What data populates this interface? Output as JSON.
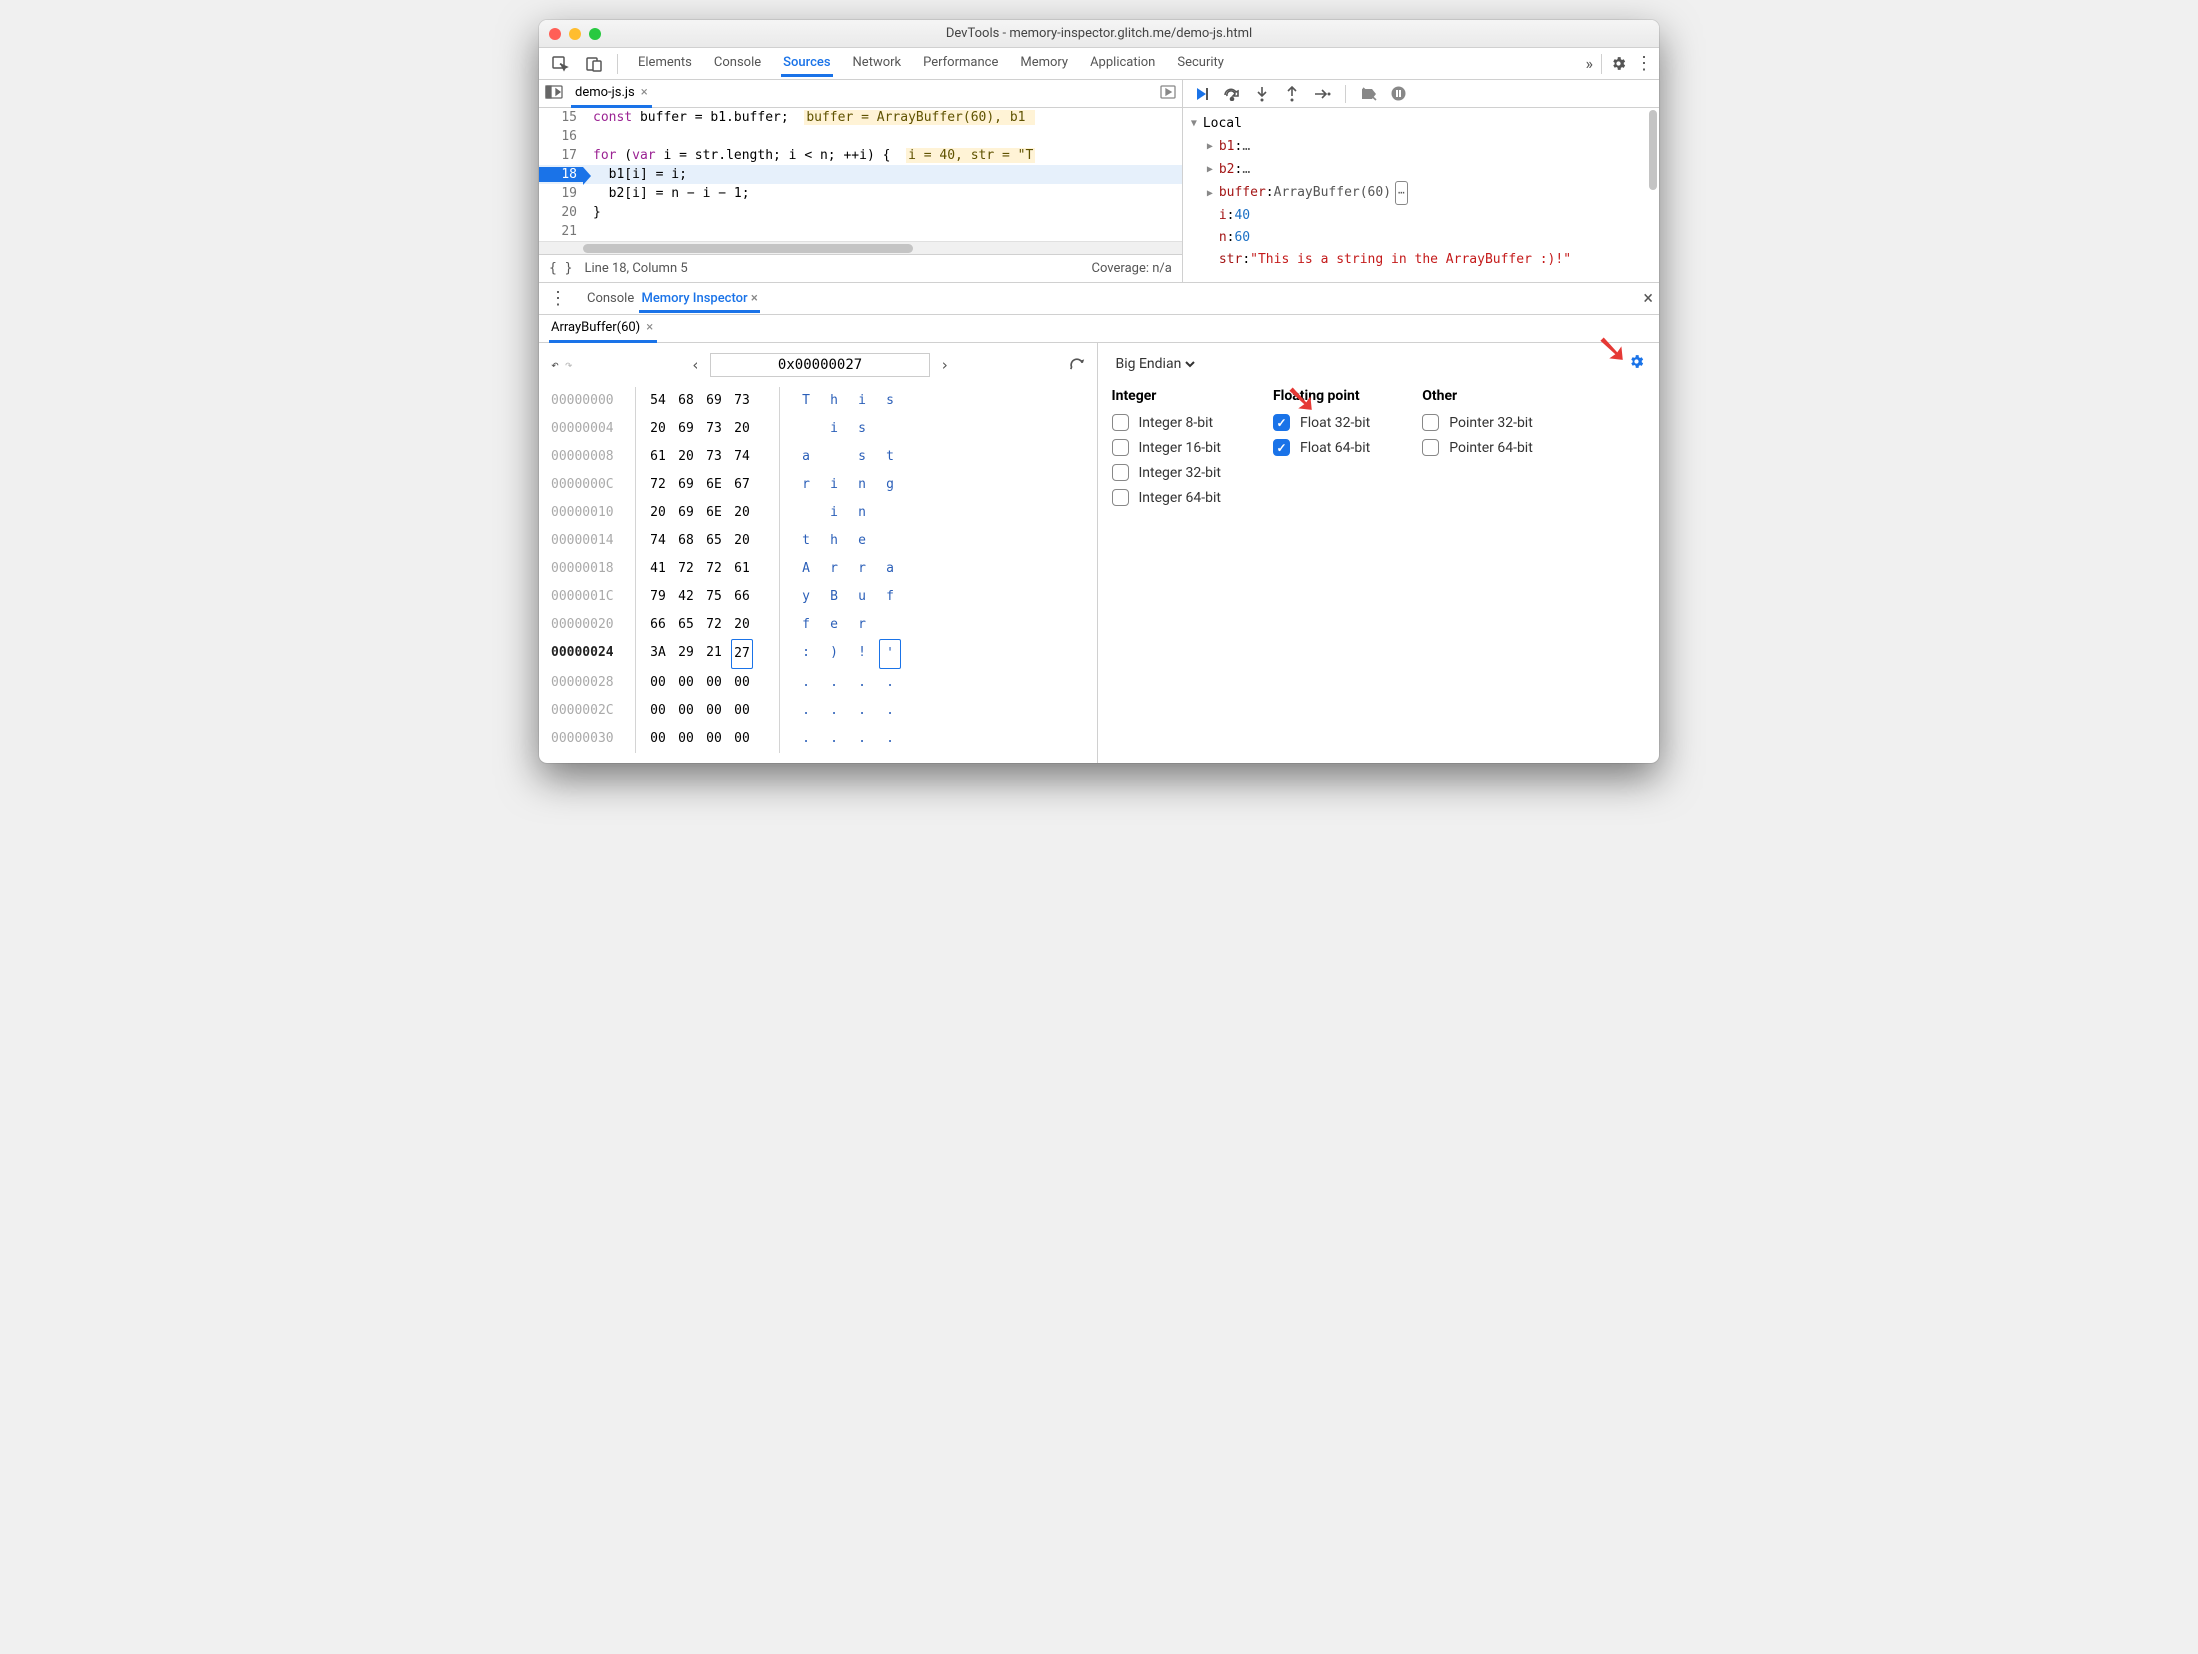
{
  "titlebar": {
    "title": "DevTools - memory-inspector.glitch.me/demo-js.html"
  },
  "tabs": {
    "items": [
      "Elements",
      "Console",
      "Sources",
      "Network",
      "Performance",
      "Memory",
      "Application",
      "Security"
    ],
    "active": "Sources",
    "more": "»"
  },
  "sources": {
    "file_tab": "demo-js.js",
    "lines": [
      {
        "n": "15",
        "html": "<span class='kw'>const</span> buffer = b1.buffer;&nbsp; <span class='hint'>buffer = ArrayBuffer(60), b1 </span>"
      },
      {
        "n": "16",
        "html": ""
      },
      {
        "n": "17",
        "html": "<span class='kw'>for</span> (<span class='kw'>var</span> i = str.length; i &lt; n; ++i) {&nbsp; <span class='hint'>i = 40, str = \"T</span>"
      },
      {
        "n": "18",
        "html": "&nbsp;&nbsp;b1[i] = i;",
        "active": true
      },
      {
        "n": "19",
        "html": "&nbsp;&nbsp;b2[i] = n &minus; i &minus; 1;"
      },
      {
        "n": "20",
        "html": "}"
      },
      {
        "n": "21",
        "html": ""
      }
    ],
    "status": {
      "pos": "Line 18, Column 5",
      "coverage": "Coverage: n/a"
    }
  },
  "scope": {
    "header": "Local",
    "entries": [
      {
        "key": "b1",
        "val": "…",
        "expandable": true
      },
      {
        "key": "b2",
        "val": "…",
        "expandable": true
      },
      {
        "key": "buffer",
        "val": "ArrayBuffer(60)",
        "expandable": true,
        "memicon": true
      },
      {
        "key": "i",
        "val": "40",
        "num": true
      },
      {
        "key": "n",
        "val": "60",
        "num": true
      },
      {
        "key": "str",
        "val": "\"This is a string in the ArrayBuffer :)!\"",
        "str": true
      }
    ]
  },
  "drawer": {
    "tabs": [
      "Console",
      "Memory Inspector"
    ],
    "active": "Memory Inspector"
  },
  "mi": {
    "tab": "ArrayBuffer(60)",
    "address": "0x00000027",
    "rows": [
      {
        "addr": "00000000",
        "bytes": [
          "54",
          "68",
          "69",
          "73"
        ],
        "ascii": [
          "T",
          "h",
          "i",
          "s"
        ]
      },
      {
        "addr": "00000004",
        "bytes": [
          "20",
          "69",
          "73",
          "20"
        ],
        "ascii": [
          "",
          "i",
          "s",
          ""
        ]
      },
      {
        "addr": "00000008",
        "bytes": [
          "61",
          "20",
          "73",
          "74"
        ],
        "ascii": [
          "a",
          "",
          "s",
          "t"
        ]
      },
      {
        "addr": "0000000C",
        "bytes": [
          "72",
          "69",
          "6E",
          "67"
        ],
        "ascii": [
          "r",
          "i",
          "n",
          "g"
        ]
      },
      {
        "addr": "00000010",
        "bytes": [
          "20",
          "69",
          "6E",
          "20"
        ],
        "ascii": [
          "",
          "i",
          "n",
          ""
        ]
      },
      {
        "addr": "00000014",
        "bytes": [
          "74",
          "68",
          "65",
          "20"
        ],
        "ascii": [
          "t",
          "h",
          "e",
          ""
        ]
      },
      {
        "addr": "00000018",
        "bytes": [
          "41",
          "72",
          "72",
          "61"
        ],
        "ascii": [
          "A",
          "r",
          "r",
          "a"
        ]
      },
      {
        "addr": "0000001C",
        "bytes": [
          "79",
          "42",
          "75",
          "66"
        ],
        "ascii": [
          "y",
          "B",
          "u",
          "f"
        ]
      },
      {
        "addr": "00000020",
        "bytes": [
          "66",
          "65",
          "72",
          "20"
        ],
        "ascii": [
          "f",
          "e",
          "r",
          ""
        ]
      },
      {
        "addr": "00000024",
        "bytes": [
          "3A",
          "29",
          "21",
          "27"
        ],
        "ascii": [
          ":",
          ")",
          "!",
          "'"
        ],
        "hot": true,
        "selcol": 3
      },
      {
        "addr": "00000028",
        "bytes": [
          "00",
          "00",
          "00",
          "00"
        ],
        "ascii": [
          ".",
          ".",
          ".",
          "."
        ]
      },
      {
        "addr": "0000002C",
        "bytes": [
          "00",
          "00",
          "00",
          "00"
        ],
        "ascii": [
          ".",
          ".",
          ".",
          "."
        ]
      },
      {
        "addr": "00000030",
        "bytes": [
          "00",
          "00",
          "00",
          "00"
        ],
        "ascii": [
          ".",
          ".",
          ".",
          "."
        ]
      }
    ],
    "endian": "Big Endian",
    "settings": {
      "cols": [
        {
          "title": "Integer",
          "opts": [
            {
              "label": "Integer 8-bit",
              "checked": false
            },
            {
              "label": "Integer 16-bit",
              "checked": false
            },
            {
              "label": "Integer 32-bit",
              "checked": false
            },
            {
              "label": "Integer 64-bit",
              "checked": false
            }
          ]
        },
        {
          "title": "Floating point",
          "opts": [
            {
              "label": "Float 32-bit",
              "checked": true
            },
            {
              "label": "Float 64-bit",
              "checked": true
            }
          ]
        },
        {
          "title": "Other",
          "opts": [
            {
              "label": "Pointer 32-bit",
              "checked": false
            },
            {
              "label": "Pointer 64-bit",
              "checked": false
            }
          ]
        }
      ]
    }
  }
}
